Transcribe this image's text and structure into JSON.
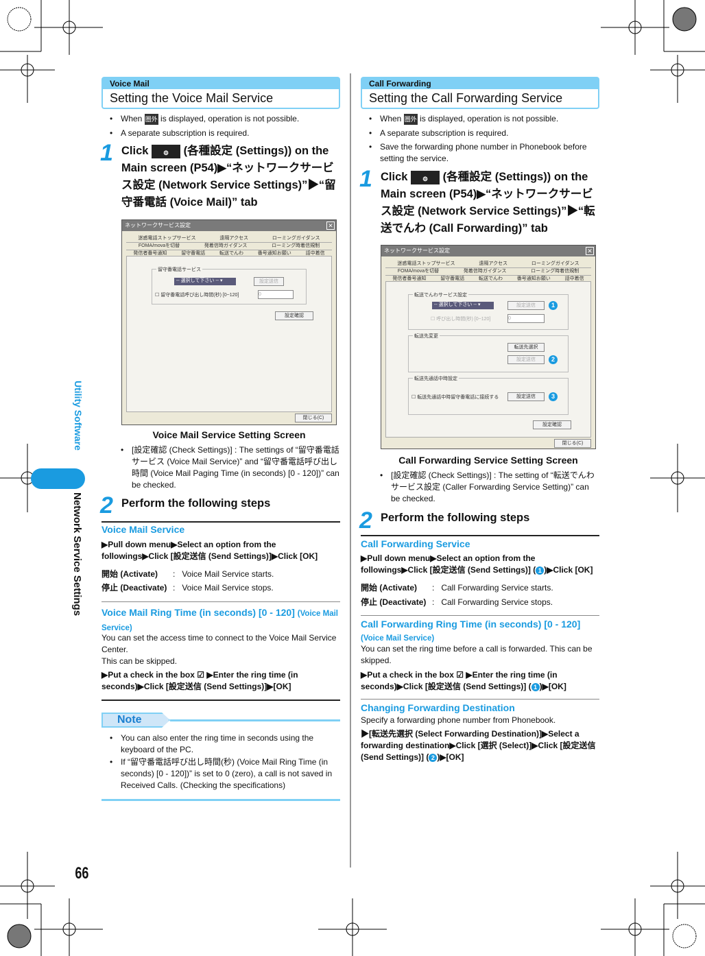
{
  "side": {
    "section": "Utility Software",
    "chapter": "Network Service Settings",
    "page": "66"
  },
  "colors": {
    "accent": "#1a9be0",
    "header": "#7fd0f5"
  },
  "left": {
    "category": "Voice Mail",
    "title": "Setting the Voice Mail Service",
    "bullets": [
      "When",
      "is displayed, operation is not possible.",
      "A separate subscription is required."
    ],
    "icon_out": "圏外",
    "step1": {
      "num": "1",
      "pre": "Click",
      "post": "(各種設定 (Settings)) on the Main screen (P54)▶“ネットワークサービス設定 (Network Service Settings)”▶“留守番電話 (Voice Mail)” tab"
    },
    "dialog": {
      "title": "ネットワークサービス設定",
      "tabs_row1": [
        "迷惑電話ストップサービス",
        "遠隔アクセス",
        "ローミングガイダンス"
      ],
      "tabs_row2": [
        "FOMA/movaを切替",
        "発着信時ガイダンス",
        "ローミング時着信規制"
      ],
      "tabs_row3": [
        "発信者番号通知",
        "留守番電話",
        "転送でんわ",
        "番号通知お願い",
        "話中着信"
      ],
      "group": "留守番電話サービス",
      "select": "-- 選択して下さい --",
      "send": "設定送信",
      "ring": "留守番電話呼び出し時間(秒) [0~120]",
      "ring_value": "0",
      "check": "設定確認",
      "close": "閉じる(C)"
    },
    "caption": "Voice Mail Service Setting Screen",
    "note1": "[設定確認 (Check Settings)] :  The settings of “留守番電話サービス (Voice Mail Service)” and “留守番電話呼び出し時間 (Voice Mail Paging Time (in seconds) [0 - 120])” can be checked.",
    "step2": {
      "num": "2",
      "text": "Perform the following steps"
    },
    "vm_head": "Voice Mail Service",
    "vm_proc": "▶Pull down menu▶Select an option from the followings▶Click [設定送信 (Send Settings)]▶Click [OK]",
    "opts": [
      {
        "k": "開始 (Activate)",
        "v": "Voice Mail Service starts."
      },
      {
        "k": "停止 (Deactivate)",
        "v": "Voice Mail Service stops."
      }
    ],
    "ring_head": "Voice Mail Ring Time (in seconds) [0 - 120]",
    "ring_head_small": "(Voice Mail Service)",
    "ring_desc": "You can set the access time to connect to the Voice Mail Service Center.",
    "ring_skip": "This can be skipped.",
    "ring_proc": "▶Put a check in the box ☑ ▶Enter the ring time (in seconds)▶Click [設定送信 (Send Settings)]▶[OK]",
    "note_label": "Note",
    "notes": [
      "You can also enter the ring time in seconds using the keyboard of the PC.",
      "If “留守番電話呼び出し時間(秒) (Voice Mail Ring Time (in seconds) [0 - 120])” is set to 0 (zero), a call is not saved in Received Calls. (Checking the specifications)"
    ]
  },
  "right": {
    "category": "Call Forwarding",
    "title": "Setting the Call Forwarding Service",
    "bullets": [
      "When",
      "is displayed, operation is not possible.",
      "A separate subscription is required.",
      "Save the forwarding phone number in Phonebook before setting the service."
    ],
    "step1": {
      "num": "1",
      "pre": "Click",
      "post": "(各種設定 (Settings)) on the Main screen (P54)▶“ネットワークサービス設定 (Network Service Settings)”▶“転送でんわ (Call Forwarding)” tab"
    },
    "dialog": {
      "title": "ネットワークサービス設定",
      "tabs_row1": [
        "迷惑電話ストップサービス",
        "遠隔アクセス",
        "ローミングガイダンス"
      ],
      "tabs_row2": [
        "FOMA/movaを切替",
        "発着信時ガイダンス",
        "ローミング時着信規制"
      ],
      "tabs_row3": [
        "発信者番号通知",
        "留守番電話",
        "転送でんわ",
        "番号通知お願い",
        "話中着信"
      ],
      "group1": "転送でんわサービス設定",
      "select": "-- 選択して下さい --",
      "send": "設定送信",
      "ring": "呼び出し時間(秒) [0~120]",
      "ring_value": "0",
      "group2": "転送先変更",
      "select_dest": "転送先選択",
      "group3": "転送先通話中時設定",
      "busy": "転送先通話中時留守番電話に接続する",
      "check": "設定確認",
      "close": "閉じる(C)",
      "markers": [
        "1",
        "2",
        "3"
      ]
    },
    "caption": "Call Forwarding Service Setting Screen",
    "note1": "[設定確認 (Check Settings)] :  The setting of “転送でんわサービス設定 (Caller Forwarding Service Setting)” can be checked.",
    "step2": {
      "num": "2",
      "text": "Perform the following steps"
    },
    "cf_head": "Call Forwarding Service",
    "cf_proc_a": "▶Pull down menu▶Select an option from the followings▶Click [設定送信 (Send Settings)] (",
    "cf_proc_b": ")▶Click [OK]",
    "opts": [
      {
        "k": "開始 (Activate)",
        "v": "Call Forwarding Service starts."
      },
      {
        "k": "停止 (Deactivate)",
        "v": "Call Forwarding Service stops."
      }
    ],
    "ring_head": "Call Forwarding Ring Time (in seconds) [0 - 120]",
    "ring_head_small": "(Voice Mail Service)",
    "ring_desc": "You can set the ring time before a call is forwarded. This can be skipped.",
    "ring_proc_a": "▶Put a check in the box ☑ ▶Enter the ring time (in seconds)▶Click [設定送信 (Send Settings)] (",
    "ring_proc_b": ")▶[OK]",
    "dest_head": "Changing Forwarding Destination",
    "dest_desc": "Specify a forwarding phone number from Phonebook.",
    "dest_proc_a": "▶[転送先選択 (Select Forwarding Destination)]▶Select a forwarding destination▶Click [選択 (Select)]▶Click [設定送信 (Send Settings)] (",
    "dest_proc_b": ")▶[OK]"
  }
}
